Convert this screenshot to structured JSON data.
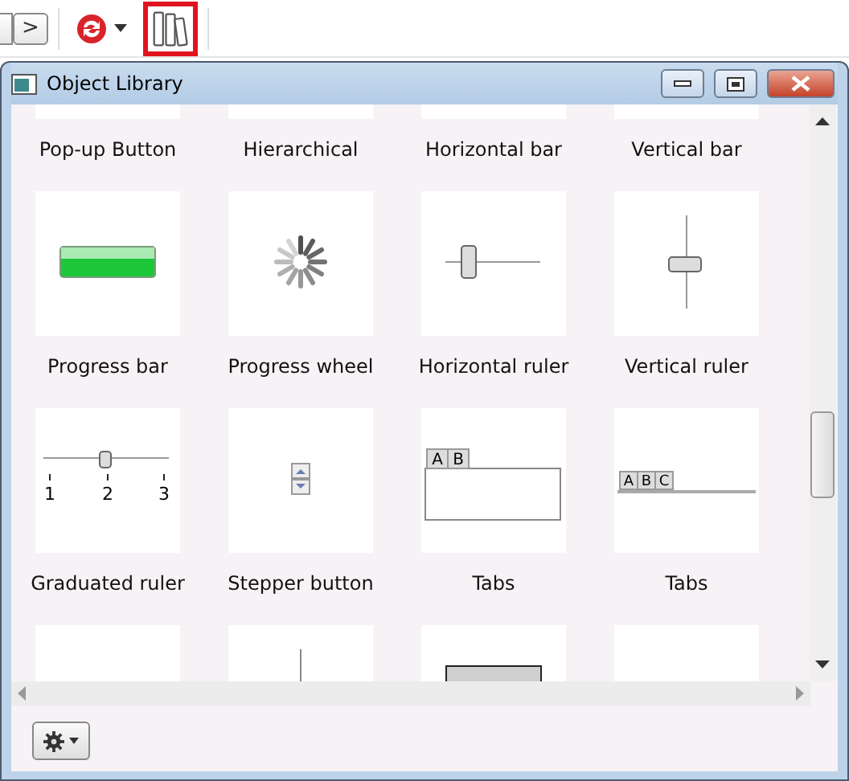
{
  "toolbar": {
    "nav_button": {
      "label": ">"
    },
    "sync_button": {
      "has_menu": true
    },
    "library_button": {
      "selected": true
    }
  },
  "window": {
    "title": "Object Library"
  },
  "tiles": [
    {
      "kind": "plain",
      "label": "Pop-up Button"
    },
    {
      "kind": "plain",
      "label": "Hierarchical"
    },
    {
      "kind": "plain",
      "label": "Horizontal bar"
    },
    {
      "kind": "plain",
      "label": "Vertical bar"
    },
    {
      "kind": "progress-bar",
      "label": "Progress bar"
    },
    {
      "kind": "progress-wheel",
      "label": "Progress wheel"
    },
    {
      "kind": "h-slider",
      "label": "Horizontal ruler"
    },
    {
      "kind": "v-slider",
      "label": "Vertical ruler"
    },
    {
      "kind": "graduated",
      "label": "Graduated ruler",
      "ticks": [
        "1",
        "2",
        "3"
      ]
    },
    {
      "kind": "stepper",
      "label": "Stepper button"
    },
    {
      "kind": "tabs-box",
      "label": "Tabs",
      "tabs": [
        "A",
        "B"
      ]
    },
    {
      "kind": "tabs-line",
      "label": "Tabs",
      "tabs": [
        "A",
        "B",
        "C"
      ]
    },
    {
      "kind": "plain"
    },
    {
      "kind": "line"
    },
    {
      "kind": "box"
    },
    {
      "kind": "plain"
    }
  ]
}
